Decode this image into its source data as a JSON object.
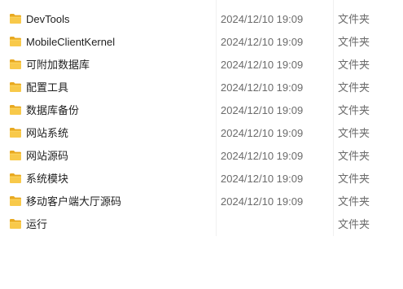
{
  "files": [
    {
      "name": "DevTools",
      "date": "2024/12/10 19:09",
      "type": "文件夹",
      "icon": "folder-icon"
    },
    {
      "name": "MobileClientKernel",
      "date": "2024/12/10 19:09",
      "type": "文件夹",
      "icon": "folder-icon"
    },
    {
      "name": "可附加数据库",
      "date": "2024/12/10 19:09",
      "type": "文件夹",
      "icon": "folder-icon"
    },
    {
      "name": "配置工具",
      "date": "2024/12/10 19:09",
      "type": "文件夹",
      "icon": "folder-icon"
    },
    {
      "name": "数据库备份",
      "date": "2024/12/10 19:09",
      "type": "文件夹",
      "icon": "folder-icon"
    },
    {
      "name": "网站系统",
      "date": "2024/12/10 19:09",
      "type": "文件夹",
      "icon": "folder-icon"
    },
    {
      "name": "网站源码",
      "date": "2024/12/10 19:09",
      "type": "文件夹",
      "icon": "folder-icon"
    },
    {
      "name": "系统模块",
      "date": "2024/12/10 19:09",
      "type": "文件夹",
      "icon": "folder-icon"
    },
    {
      "name": "移动客户端大厅源码",
      "date": "2024/12/10 19:09",
      "type": "文件夹",
      "icon": "folder-icon"
    },
    {
      "name": "运行",
      "date": "",
      "type": "文件夹",
      "icon": "folder-icon"
    }
  ],
  "colors": {
    "folder_body": "#f8c94a",
    "folder_tab": "#e8a921",
    "folder_front": "#fbd560"
  }
}
